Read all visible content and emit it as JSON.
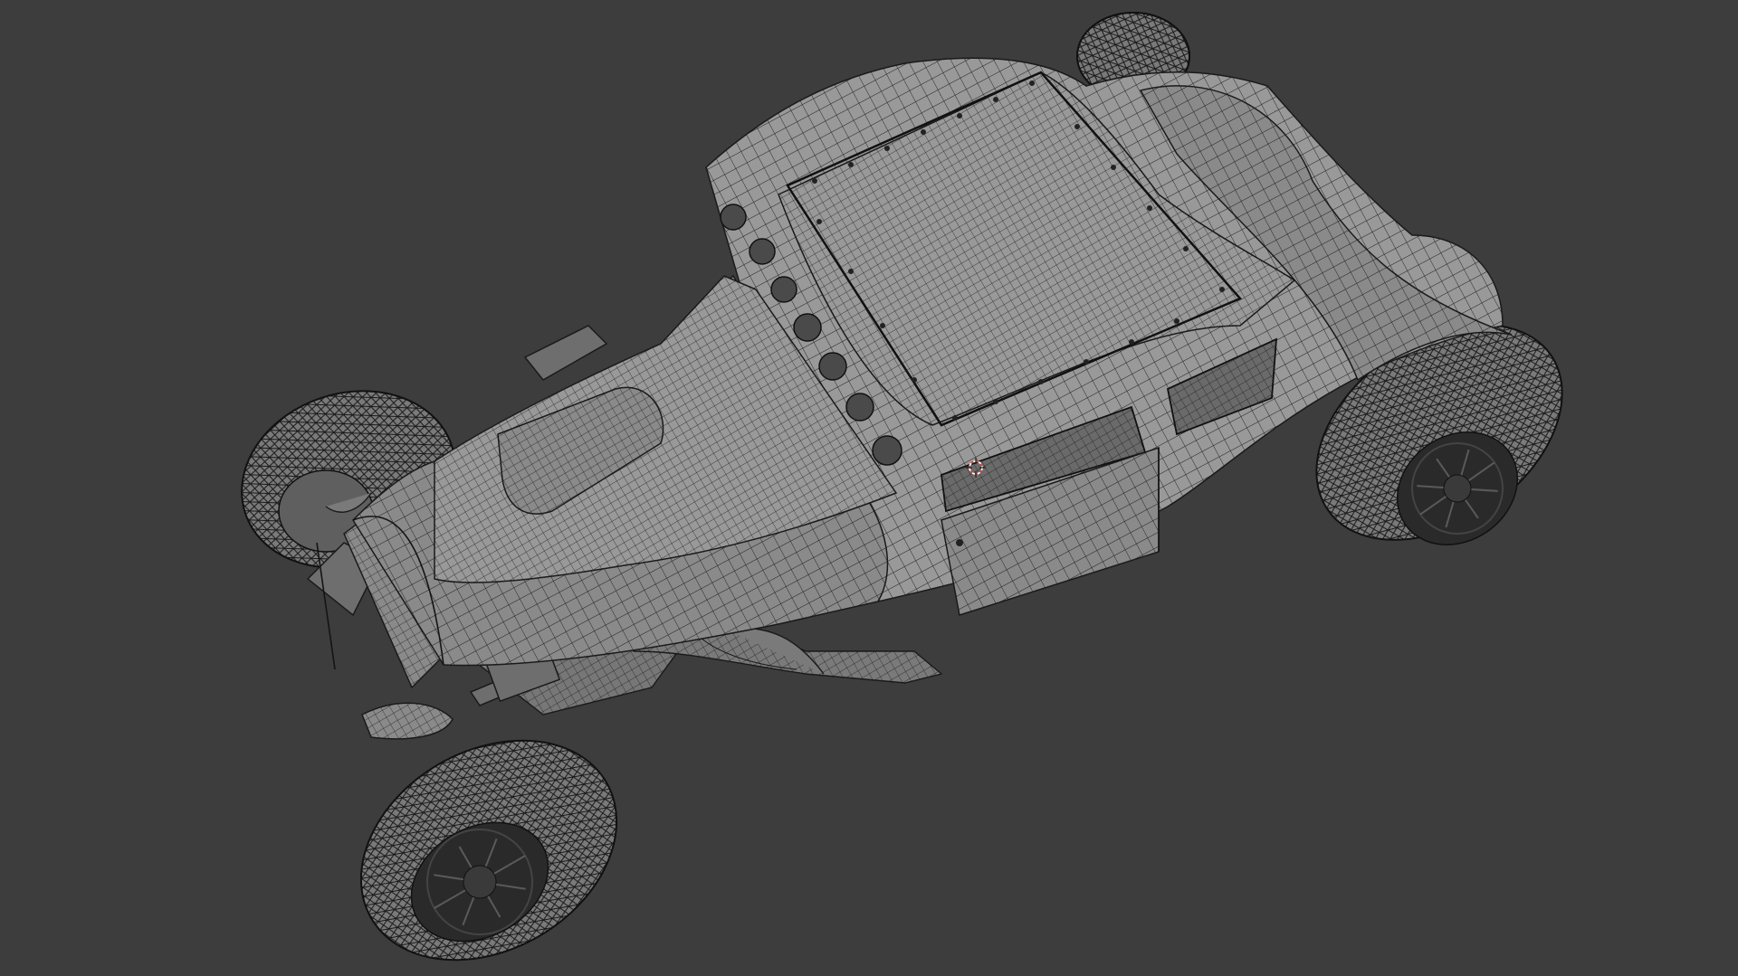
{
  "viewport": {
    "mode": "wireframe-overlay",
    "background_color": "#3d3d3d",
    "mesh_color": "#8a8a8a",
    "wire_color": "#1b1b1b",
    "cursor_color": "#e04040"
  },
  "scene": {
    "object": "hot-rod-coupe",
    "parts": [
      "body",
      "roof-panel",
      "hood",
      "hood-scoop",
      "windshield",
      "side-window",
      "door",
      "front-left-wheel",
      "front-right-wheel",
      "rear-left-wheel",
      "rear-right-wheel",
      "exhaust-headers",
      "engine",
      "frame-rail",
      "radiator-grille",
      "roof-vents"
    ],
    "roof_vent_count": 7
  },
  "icons": {
    "cursor": "3d-cursor-icon"
  }
}
